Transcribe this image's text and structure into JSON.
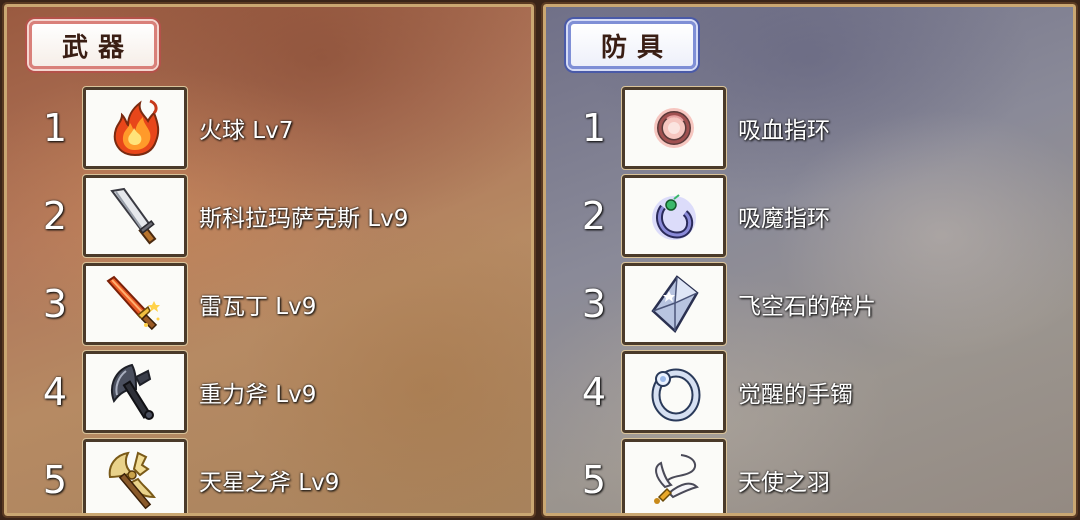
{
  "weapons": {
    "title": "武器",
    "items": [
      {
        "rank": "1",
        "name": "火球 Lv7",
        "icon": "fireball-icon"
      },
      {
        "rank": "2",
        "name": "斯科拉玛萨克斯 Lv9",
        "icon": "cleaver-sword-icon"
      },
      {
        "rank": "3",
        "name": "雷瓦丁 Lv9",
        "icon": "flame-sword-icon"
      },
      {
        "rank": "4",
        "name": "重力斧 Lv9",
        "icon": "gravity-axe-icon"
      },
      {
        "rank": "5",
        "name": "天星之斧 Lv9",
        "icon": "golden-axe-icon"
      }
    ]
  },
  "armor": {
    "title": "防具",
    "items": [
      {
        "rank": "1",
        "name": "吸血指环",
        "icon": "blood-ring-icon"
      },
      {
        "rank": "2",
        "name": "吸魔指环",
        "icon": "mana-ring-icon"
      },
      {
        "rank": "3",
        "name": "飞空石的碎片",
        "icon": "crystal-shard-icon"
      },
      {
        "rank": "4",
        "name": "觉醒的手镯",
        "icon": "silver-bracelet-icon"
      },
      {
        "rank": "5",
        "name": "天使之羽",
        "icon": "angel-feather-icon"
      }
    ]
  },
  "colors": {
    "weapons_panel": "#b0765a",
    "armor_panel": "#8a8a98",
    "weapons_header_border": "#d9807a",
    "armor_header_border": "#7f8fd6",
    "panel_frame": "#caa772"
  }
}
